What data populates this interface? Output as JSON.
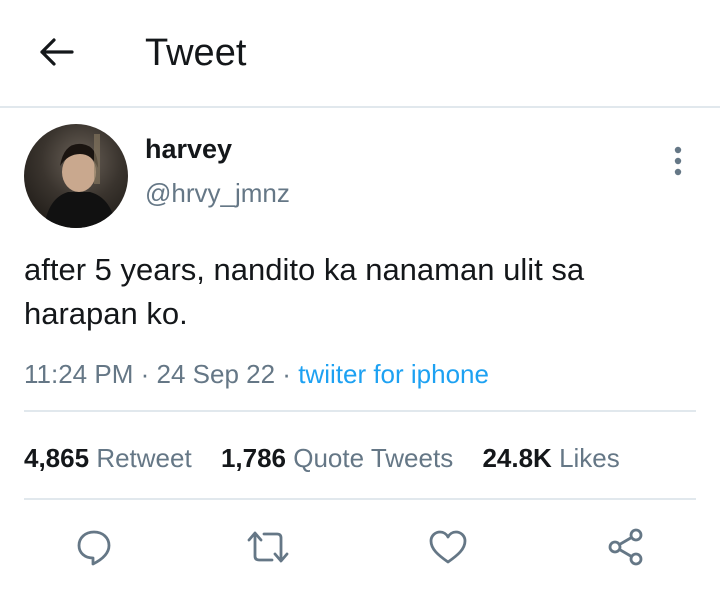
{
  "header": {
    "back_icon": "arrow-left-icon",
    "title": "Tweet"
  },
  "tweet": {
    "display_name": "harvey",
    "handle": "@hrvy_jmnz",
    "text": "after 5 years, nandito ka nanaman ulit sa harapan ko.",
    "time": "11:24 PM",
    "separator": "·",
    "date": "24 Sep 22",
    "source": "twiiter for iphone"
  },
  "stats": {
    "retweets_count": "4,865",
    "retweets_label": "Retweet",
    "quotes_count": "1,786",
    "quotes_label": "Quote Tweets",
    "likes_count": "24.8K",
    "likes_label": "Likes"
  },
  "actions": [
    "reply-icon",
    "retweet-icon",
    "like-icon",
    "share-icon"
  ],
  "colors": {
    "text": "#14171a",
    "secondary": "#657786",
    "link": "#1da1f2",
    "divider": "#e1e8ed"
  }
}
